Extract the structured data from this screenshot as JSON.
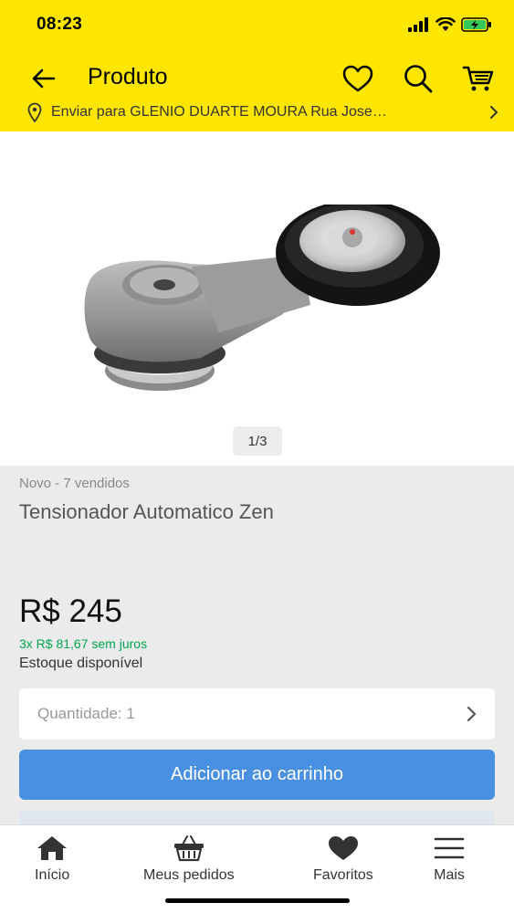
{
  "status_bar": {
    "time": "08:23"
  },
  "nav": {
    "title": "Produto"
  },
  "address": {
    "text": "Enviar para GLENIO DUARTE MOURA Rua Jose…"
  },
  "gallery": {
    "pager": "1/3"
  },
  "product": {
    "condition": "Novo - 7 vendidos",
    "title": "Tensionador Automatico Zen",
    "price": "R$ 245",
    "installments": "3x R$ 81,67 sem juros",
    "stock": "Estoque disponível"
  },
  "quantity": {
    "label": "Quantidade: 1"
  },
  "actions": {
    "add_to_cart": "Adicionar ao carrinho"
  },
  "tabbar": {
    "items": [
      {
        "label": "Início",
        "icon": "home-icon"
      },
      {
        "label": "Meus pedidos",
        "icon": "basket-icon"
      },
      {
        "label": "Favoritos",
        "icon": "heart-icon"
      },
      {
        "label": "Mais",
        "icon": "menu-icon"
      }
    ]
  },
  "colors": {
    "header": "#ffe600",
    "primary_button": "#4a90e2",
    "installments": "#00a650"
  }
}
